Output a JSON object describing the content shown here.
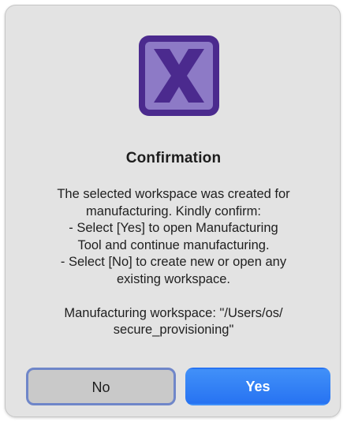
{
  "dialog": {
    "app_icon": "purple-x-app-icon",
    "title": "Confirmation",
    "message_lines": [
      "The selected workspace was created for",
      "manufacturing. Kindly confirm:",
      "- Select [Yes] to open Manufacturing",
      "Tool and continue manufacturing.",
      "- Select [No] to create new or open any",
      "existing workspace.",
      "",
      "Manufacturing workspace: \"/Users/os/",
      "secure_provisioning\""
    ],
    "buttons": {
      "no_label": "No",
      "yes_label": "Yes"
    }
  },
  "colors": {
    "icon_purple_dark": "#4b2a8e",
    "icon_purple_light": "#8d7ac6",
    "yes_button": "#2f7cf6",
    "no_button_focus_ring": "#6f86c9"
  }
}
